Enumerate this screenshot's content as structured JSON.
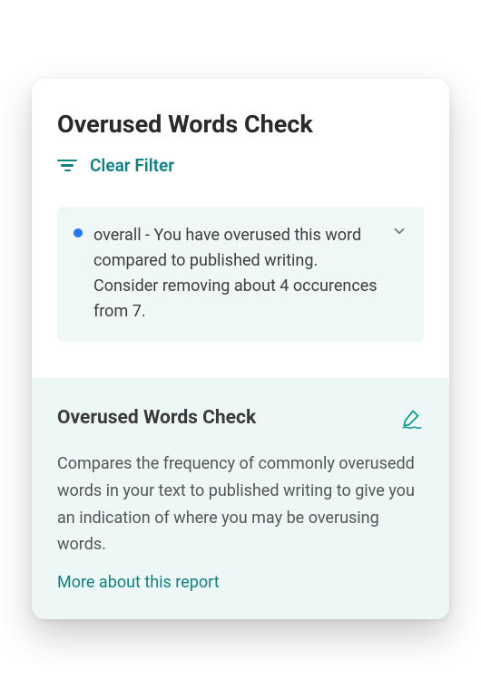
{
  "header": {
    "title": "Overused Words Check",
    "clear_filter_label": "Clear Filter"
  },
  "suggestion": {
    "text": "overall - You have overused this word compared to published writing. Consider removing about 4 occurences from 7.",
    "dot_color": "#2878ff"
  },
  "info": {
    "title": "Overused Words Check",
    "body": "Compares the frequency of commonly overusedd words in your text to published writing to give you an indication of where you may be overusing words.",
    "more_link": "More about this report"
  },
  "colors": {
    "accent": "#108080"
  }
}
